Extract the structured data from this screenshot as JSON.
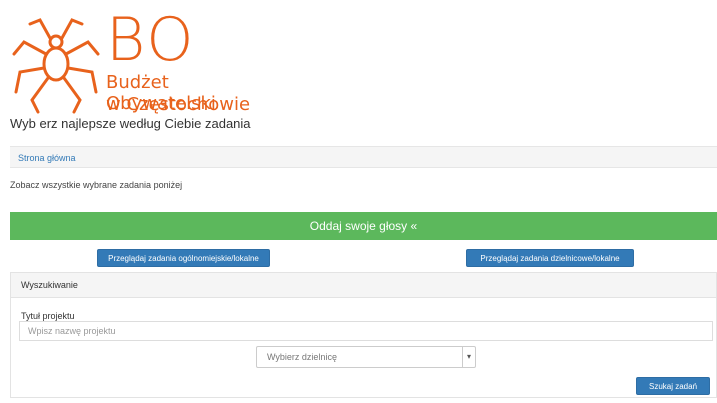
{
  "logo": {
    "bo": "BO",
    "line1": "Budżet Obywatelski",
    "line2": "w Częstochowie"
  },
  "subtitle": "Wyb erz najlepsze według Ciebie zadania",
  "nav_link": "Strona główna",
  "info_text": "Zobacz wszystkie wybrane zadania poniżej",
  "vote_button": "Oddaj swoje głosy «",
  "btn_left": "Przeglądaj zadania ogólnomiejskie/lokalne",
  "btn_right": "Przeglądaj zadania dzielnicowe/lokalne",
  "section_title": "Wyszukiwanie",
  "filter_label": "Tytuł projektu",
  "filter_placeholder": "Wpisz nazwę projektu",
  "select_value": "Wybierz dzielnicę",
  "submit_button": "Szukaj zadań",
  "colors": {
    "brand": "#e8621c",
    "green": "#5cb85c",
    "blue": "#337ab7"
  }
}
